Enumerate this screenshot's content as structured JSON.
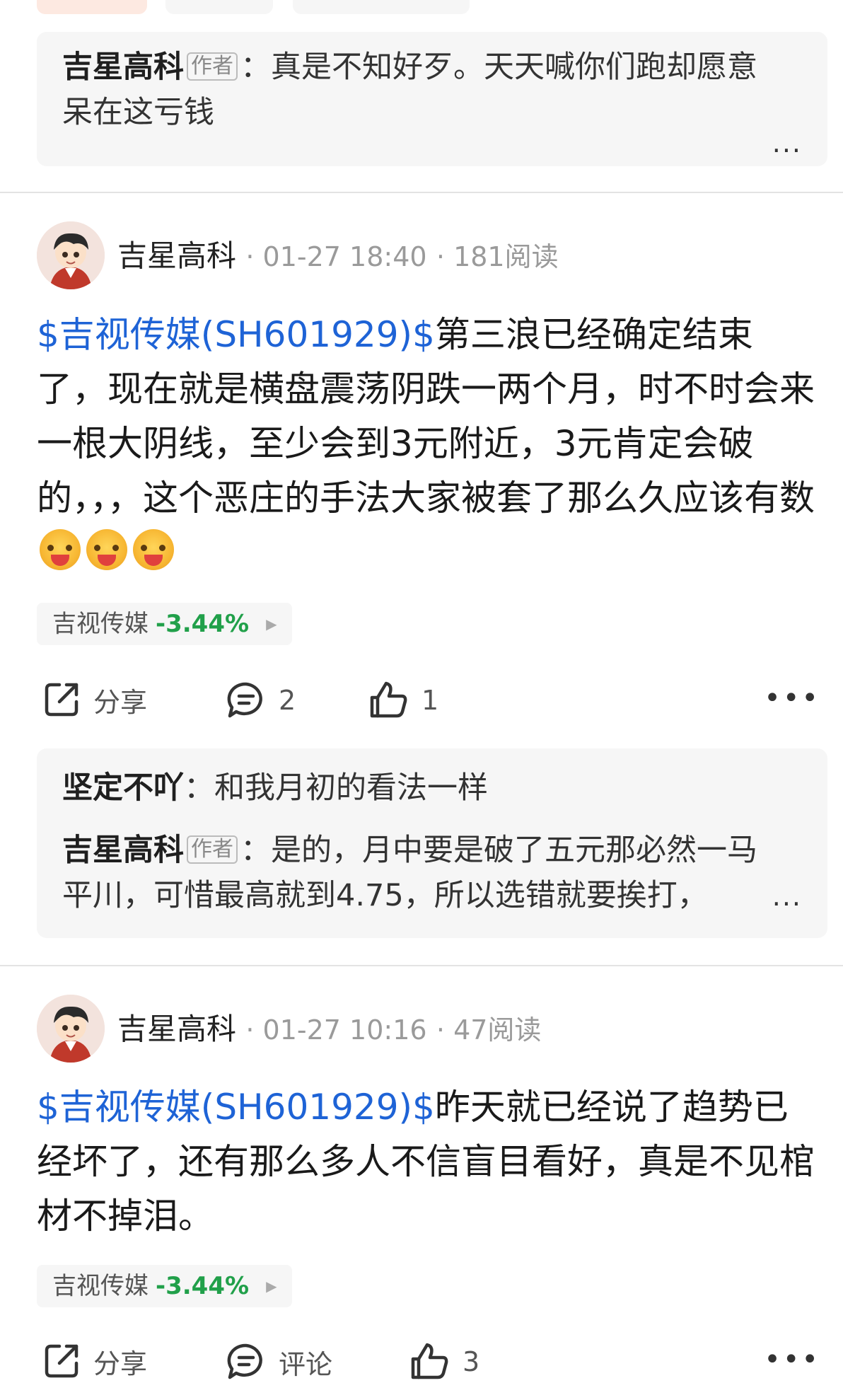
{
  "top_comment": {
    "name": "吉星高科",
    "author_tag": "作者",
    "text": "：真是不知好歹。天天喊你们跑却愿意呆在这亏钱",
    "more": "..."
  },
  "posts": [
    {
      "author": "吉星高科",
      "time": "· 01-27 18:40",
      "reads": "· 181阅读",
      "stock_tag": "$吉视传媒(SH601929)$",
      "text": "第三浪已经确定结束了，现在就是横盘震荡阴跌一两个月，时不时会来一根大阴线，至少会到3元附近，3元肯定会破的，，，这个恶庄的手法大家被套了那么久应该有数",
      "chip_name": "吉视传媒",
      "chip_change": "-3.44%",
      "share_label": "分享",
      "comment_count": "2",
      "like_count": "1",
      "more": "•••",
      "comments": [
        {
          "name": "坚定不吖",
          "text": "：和我月初的看法一样"
        },
        {
          "name": "吉星高科",
          "author_tag": "作者",
          "text": "：是的，月中要是破了五元那必然一马平川，可惜最高就到4.75，所以选错就要挨打，",
          "more": "..."
        }
      ]
    },
    {
      "author": "吉星高科",
      "time": "· 01-27 10:16",
      "reads": "· 47阅读",
      "stock_tag": "$吉视传媒(SH601929)$",
      "text": "昨天就已经说了趋势已经坏了，还有那么多人不信盲目看好，真是不见棺材不掉泪。",
      "chip_name": "吉视传媒",
      "chip_change": "-3.44%",
      "share_label": "分享",
      "comment_label": "评论",
      "like_count": "3",
      "more": "•••"
    }
  ],
  "colors": {
    "link": "#1e63d6",
    "down": "#21a04a"
  }
}
